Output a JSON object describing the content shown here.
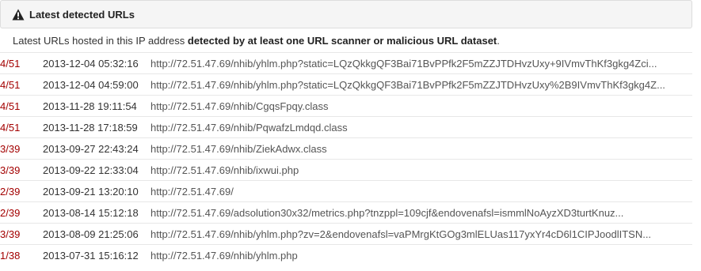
{
  "panel": {
    "title": "Latest detected URLs",
    "icon": "warning-icon"
  },
  "intro": {
    "prefix": "Latest URLs hosted in this IP address ",
    "bold": "detected by at least one URL scanner or malicious URL dataset",
    "suffix": "."
  },
  "colors": {
    "ratio": "#a30000",
    "header_bg": "#f5f5f5"
  },
  "rows": [
    {
      "ratio": "4/51",
      "date": "2013-12-04 05:32:16",
      "url": "http://72.51.47.69/nhib/yhlm.php?static=LQzQkkgQF3Bai71BvPPfk2F5mZZJTDHvzUxy+9IVmvThKf3gkg4Zci..."
    },
    {
      "ratio": "4/51",
      "date": "2013-12-04 04:59:00",
      "url": "http://72.51.47.69/nhib/yhlm.php?static=LQzQkkgQF3Bai71BvPPfk2F5mZZJTDHvzUxy%2B9IVmvThKf3gkg4Z..."
    },
    {
      "ratio": "4/51",
      "date": "2013-11-28 19:11:54",
      "url": "http://72.51.47.69/nhib/CgqsFpqy.class"
    },
    {
      "ratio": "4/51",
      "date": "2013-11-28 17:18:59",
      "url": "http://72.51.47.69/nhib/PqwafzLmdqd.class"
    },
    {
      "ratio": "3/39",
      "date": "2013-09-27 22:43:24",
      "url": "http://72.51.47.69/nhib/ZiekAdwx.class"
    },
    {
      "ratio": "3/39",
      "date": "2013-09-22 12:33:04",
      "url": "http://72.51.47.69/nhib/ixwui.php"
    },
    {
      "ratio": "2/39",
      "date": "2013-09-21 13:20:10",
      "url": "http://72.51.47.69/"
    },
    {
      "ratio": "2/39",
      "date": "2013-08-14 15:12:18",
      "url": "http://72.51.47.69/adsolution30x32/metrics.php?tnzppl=109cjf&endovenafsl=ismmlNoAyzXD3turtKnuz..."
    },
    {
      "ratio": "3/39",
      "date": "2013-08-09 21:25:06",
      "url": "http://72.51.47.69/nhib/yhlm.php?zv=2&endovenafsl=vaPMrgKtGOg3mlELUas117yxYr4cD6l1CIPJoodlITSN..."
    },
    {
      "ratio": "1/38",
      "date": "2013-07-31 15:16:12",
      "url": "http://72.51.47.69/nhib/yhlm.php"
    }
  ]
}
